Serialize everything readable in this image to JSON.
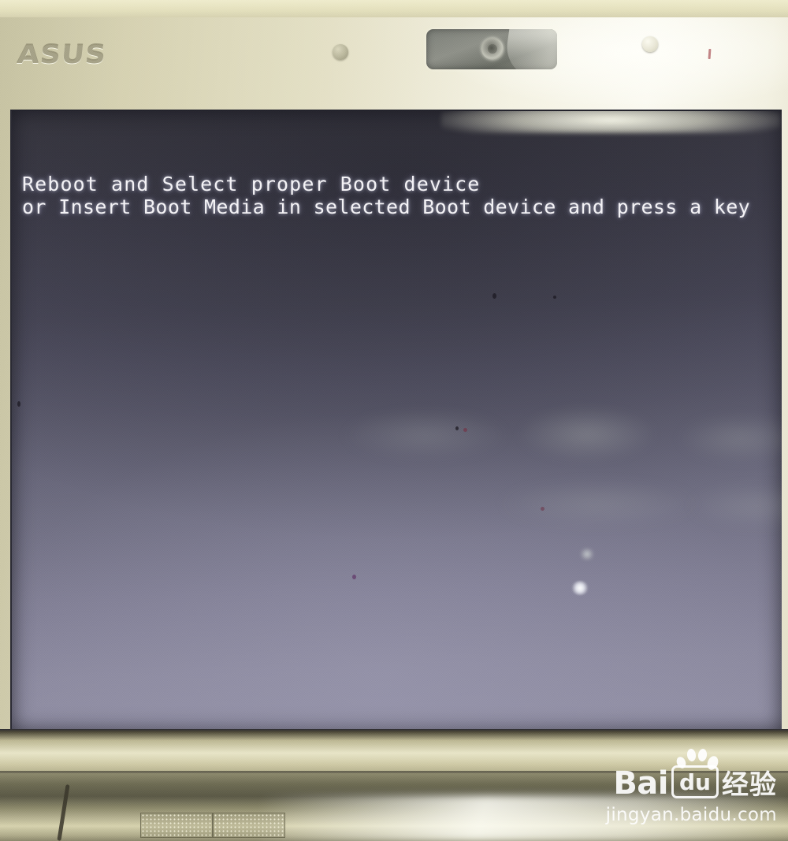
{
  "photo": {
    "subject": "laptop-boot-error-screen",
    "brand_label": "ASUS"
  },
  "bezel": {
    "brand": "ASUS",
    "webcam_icon": "webcam-icon",
    "lens_icon": "camera-lens-icon",
    "bumper_icon": "rubber-bumper-dot"
  },
  "screen": {
    "bios_message": {
      "line1": "Reboot and Select proper Boot device",
      "line2": "or Insert Boot Media in selected Boot device and press a key"
    },
    "text_color": "#f4f3f6",
    "background_top_color": "#3b3a44",
    "background_bottom_color": "#9391a7"
  },
  "base": {
    "speaker_grille_icon": "speaker-grille-icon",
    "cable_icon": "cable-icon"
  },
  "watermark": {
    "logo_bai": "Bai",
    "logo_du": "du",
    "logo_cn": "经验",
    "url": "jingyan.baidu.com",
    "paw_icon": "paw-print-icon",
    "color": "#ffffff"
  }
}
